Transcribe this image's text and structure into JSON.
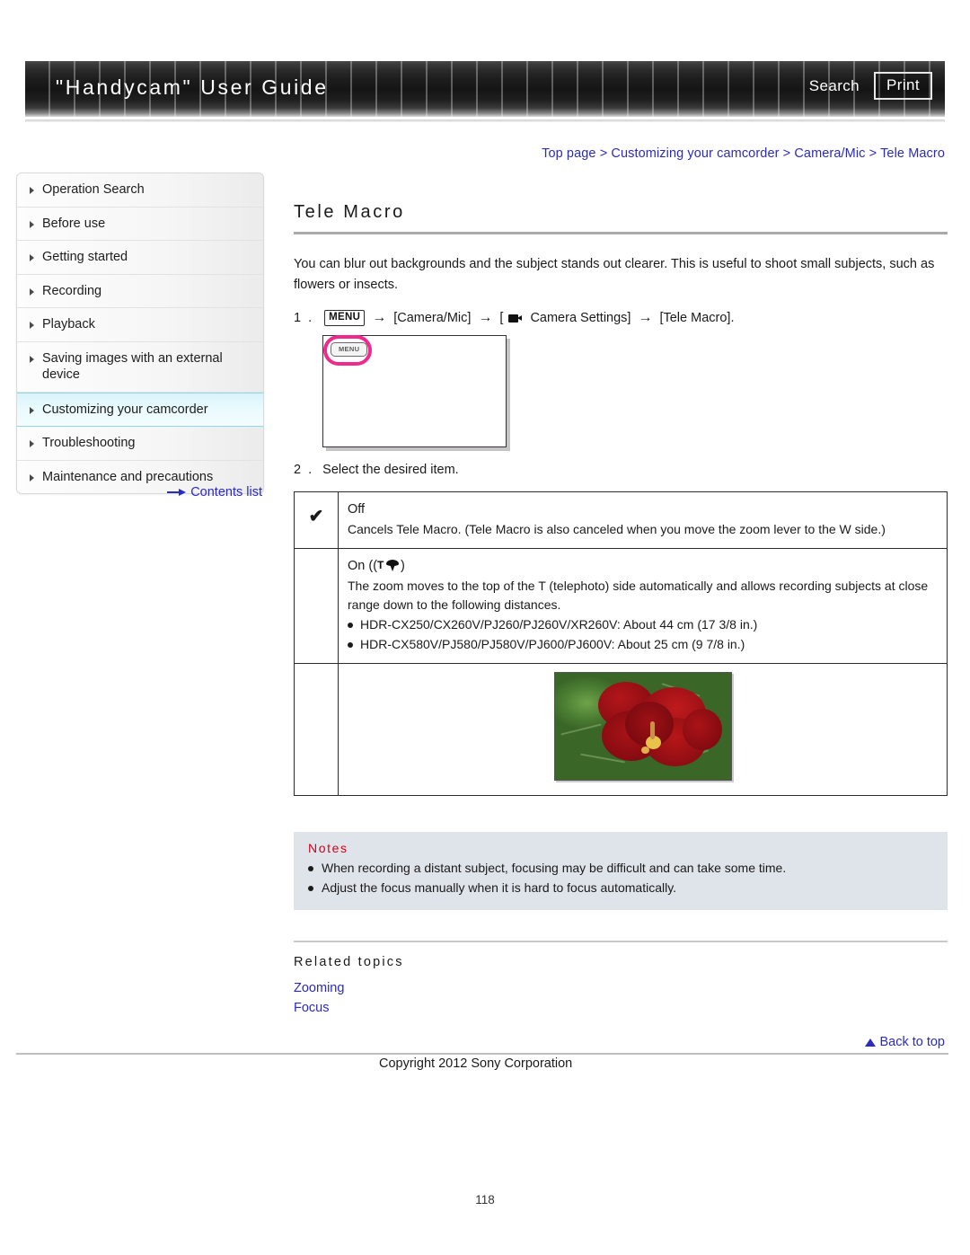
{
  "header": {
    "title": "\"Handycam\" User Guide",
    "search_label": "Search",
    "print_label": "Print"
  },
  "breadcrumb": {
    "text": "Top page > Customizing your camcorder > Camera/Mic > Tele Macro"
  },
  "sidebar": {
    "items": [
      {
        "label": "Operation Search",
        "active": false
      },
      {
        "label": "Before use",
        "active": false
      },
      {
        "label": "Getting started",
        "active": false
      },
      {
        "label": "Recording",
        "active": false
      },
      {
        "label": "Playback",
        "active": false
      },
      {
        "label": "Saving images with an external device",
        "active": false
      },
      {
        "label": "Customizing your camcorder",
        "active": true
      },
      {
        "label": "Troubleshooting",
        "active": false
      },
      {
        "label": "Maintenance and precautions",
        "active": false
      }
    ],
    "contents_link": "Contents list"
  },
  "main": {
    "title": "Tele Macro",
    "intro": "You can blur out backgrounds and the subject stands out clearer. This is useful to shoot small subjects, such as flowers or insects.",
    "step1": {
      "number": "1 .",
      "menu_chip": "MENU",
      "part1": "[Camera/Mic]",
      "part2_prefix": "[",
      "part2": "Camera Settings]",
      "part3": "[Tele Macro].",
      "arrow": "→"
    },
    "lcd": {
      "menu_button_label": "MENU"
    },
    "step2": {
      "number": "2 .",
      "text": "Select the desired item."
    },
    "options": [
      {
        "checked": "✔",
        "name": "Off",
        "has_icon": false,
        "description": "Cancels Tele Macro. (Tele Macro is also canceled when you move the zoom lever to the W side.)",
        "bullets": []
      },
      {
        "checked": "",
        "name_prefix": "On  ((",
        "name_suffix": ")",
        "icon_letter": "T",
        "has_icon": true,
        "description": "The zoom moves to the top of the T (telephoto) side automatically and allows recording subjects at close range down to the following distances.",
        "bullets": [
          "HDR-CX250/CX260V/PJ260/PJ260V/XR260V: About 44 cm (17 3/8 in.)",
          "HDR-CX580V/PJ580/PJ580V/PJ600/PJ600V: About 25 cm (9 7/8 in.)"
        ]
      }
    ],
    "photo_alt": "red-hibiscus-flower"
  },
  "notes": {
    "title": "Notes",
    "items": [
      "When recording a distant subject, focusing may be difficult and can take some time.",
      "Adjust the focus manually when it is hard to focus automatically."
    ]
  },
  "related": {
    "title": "Related topics",
    "links": [
      "Zooming",
      "Focus"
    ]
  },
  "footer": {
    "back_to_top": "Back to top",
    "copyright": "Copyright 2012 Sony Corporation",
    "page_number": "118"
  },
  "colors": {
    "link": "#2b2bbd",
    "notes_title": "#d0021b",
    "notes_bg": "#dfe3ea",
    "sidebar_active": "#d8f4fa",
    "highlight_pink": "#ef2a8c"
  }
}
